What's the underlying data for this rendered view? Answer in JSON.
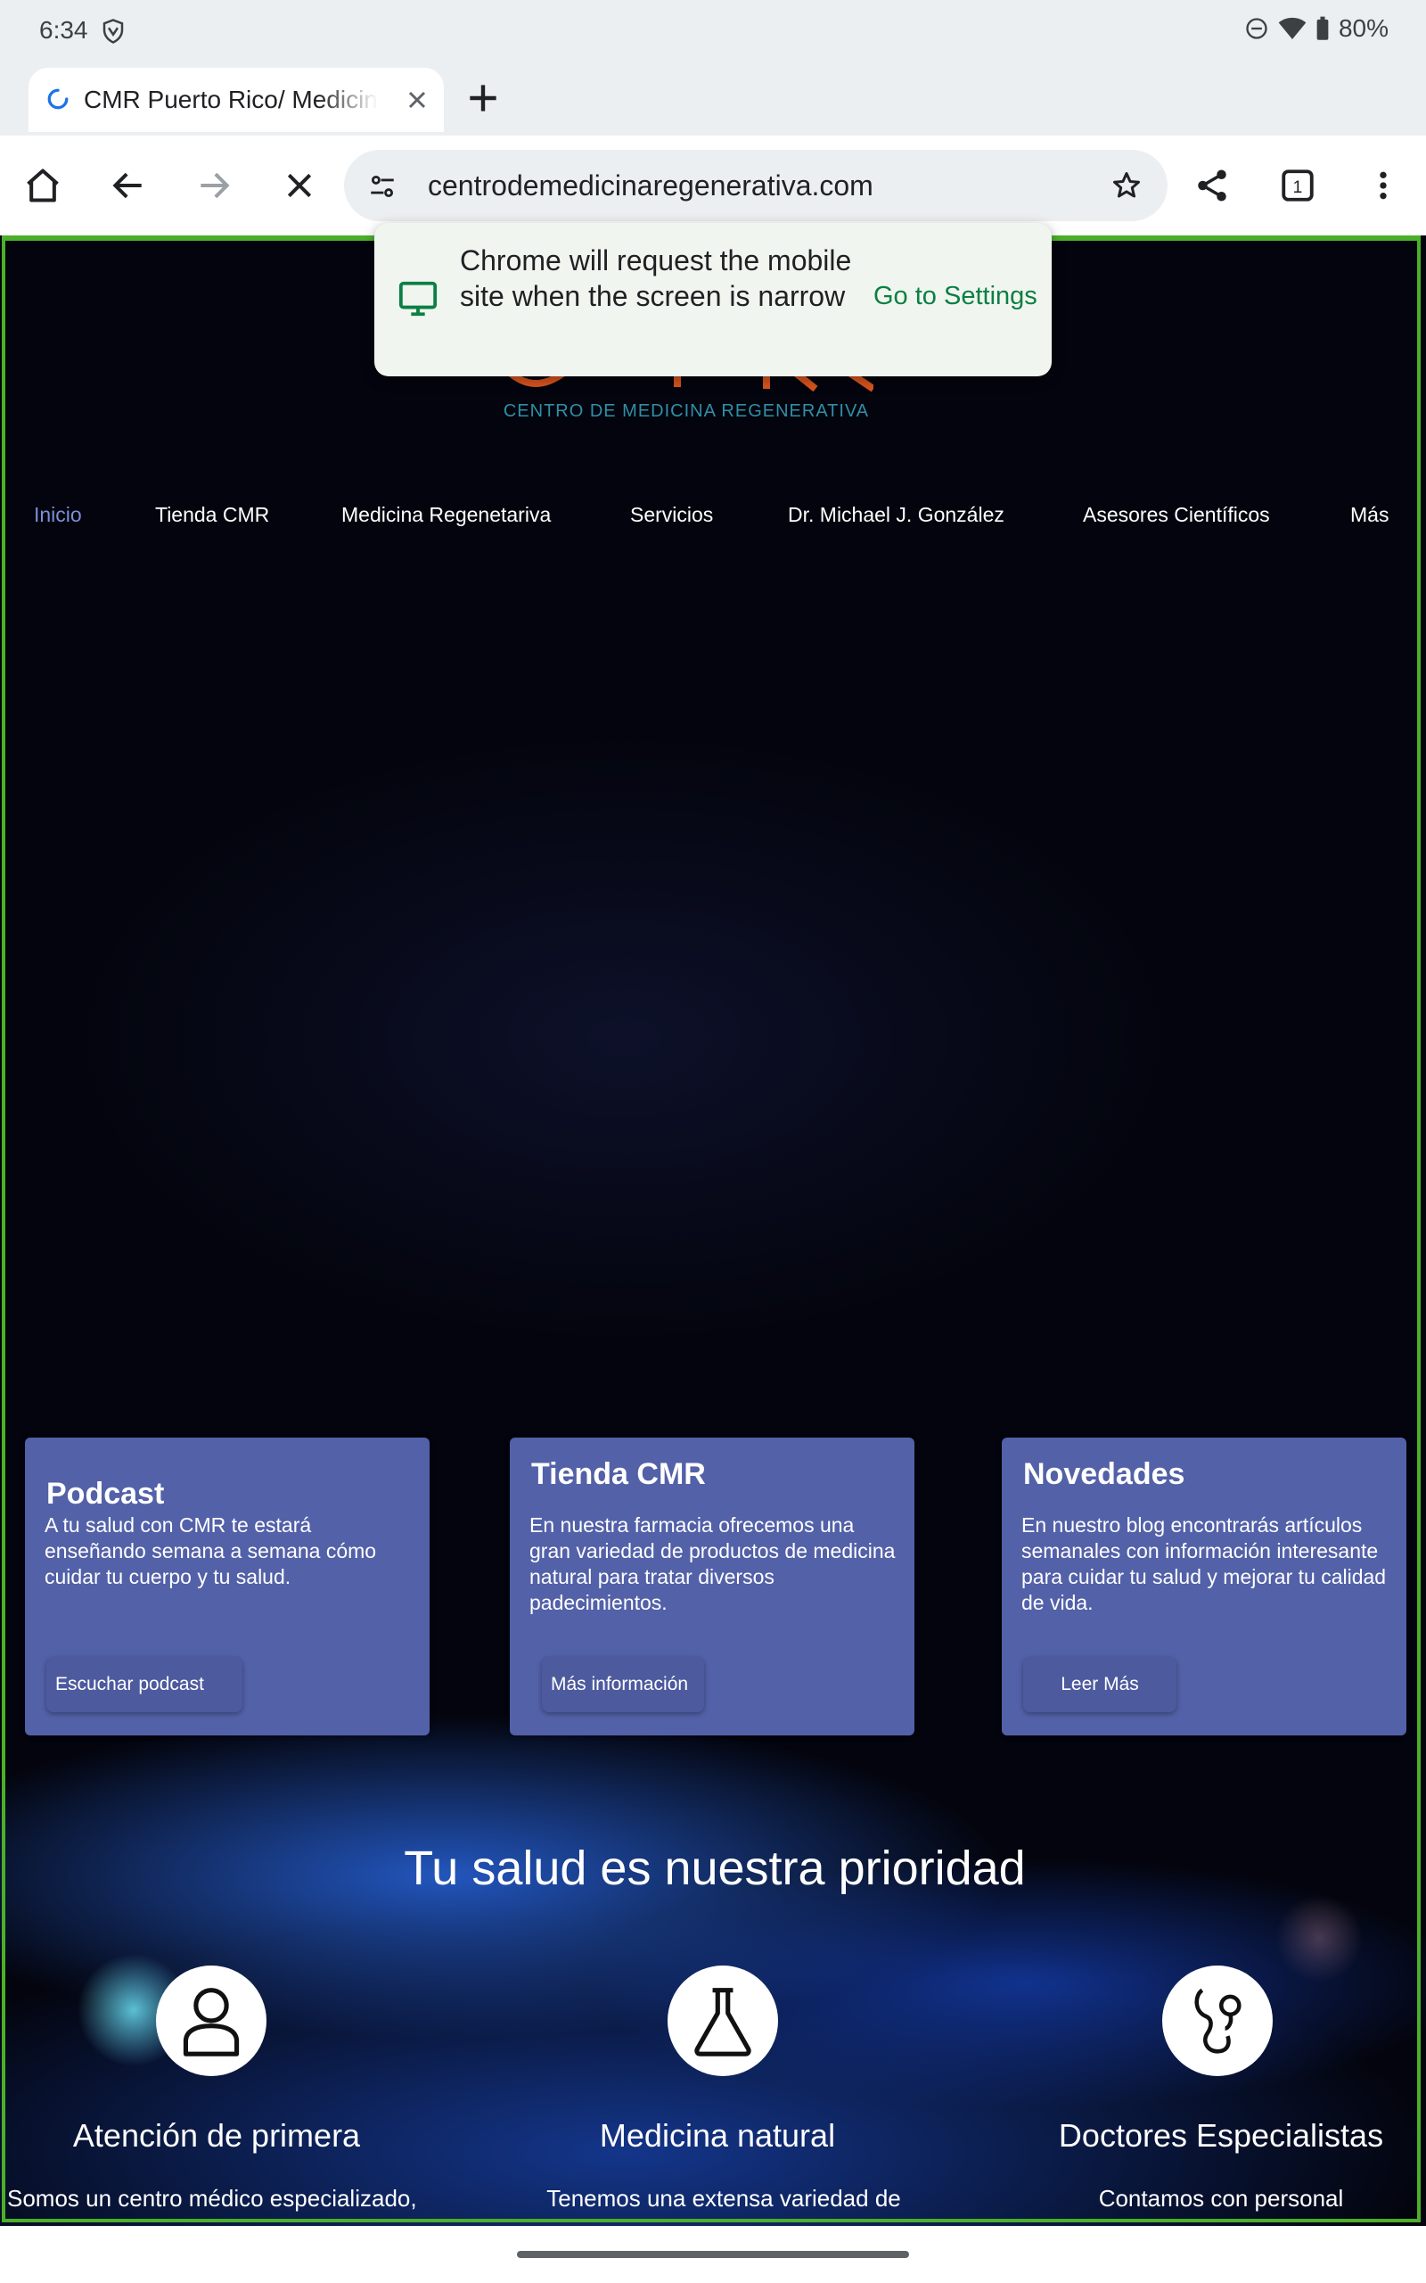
{
  "status_bar": {
    "time": "6:34",
    "battery": "80%"
  },
  "tab": {
    "title": "CMR Puerto Rico/ Medicina",
    "new_tab_label": "+"
  },
  "toolbar": {
    "url": "centrodemedicinaregenerativa.com",
    "tab_count": "1"
  },
  "popup": {
    "message": "Chrome will request the mobile site when the screen is narrow",
    "action": "Go to Settings"
  },
  "site": {
    "logo_subtitle": "CENTRO DE MEDICINA REGENERATIVA",
    "nav": [
      "Inicio",
      "Tienda CMR",
      "Medicina Regenetariva",
      "Servicios",
      "Dr. Michael J. González",
      "Asesores Científicos",
      "Más"
    ],
    "cards": [
      {
        "title": "Podcast",
        "text": "A tu salud con CMR te estará enseñando semana a semana cómo cuidar tu cuerpo y tu salud.",
        "button": "Escuchar podcast"
      },
      {
        "title": "Tienda CMR",
        "text": "En nuestra farmacia ofrecemos una gran variedad de productos de medicina natural para tratar diversos padecimientos.",
        "button": "Más información"
      },
      {
        "title": "Novedades",
        "text": "En nuestro blog encontrarás artículos semanales con información interesante para cuidar tu salud y mejorar tu calidad de vida.",
        "button": "Leer Más"
      }
    ],
    "headline": "Tu salud es nuestra prioridad",
    "features": [
      {
        "title": "Atención de primera",
        "text": "Somos un centro médico especializado,",
        "icon": "person-icon"
      },
      {
        "title": "Medicina natural",
        "text": "Tenemos una extensa variedad de",
        "icon": "flask-icon"
      },
      {
        "title": "Doctores Especialistas",
        "text": "Contamos con personal",
        "icon": "stethoscope-icon"
      }
    ]
  },
  "colors": {
    "nav_active": "#7b8fd6",
    "card_bg": "#5361a8",
    "focus_frame": "#4caf2a",
    "popup_link": "#0b8043"
  }
}
